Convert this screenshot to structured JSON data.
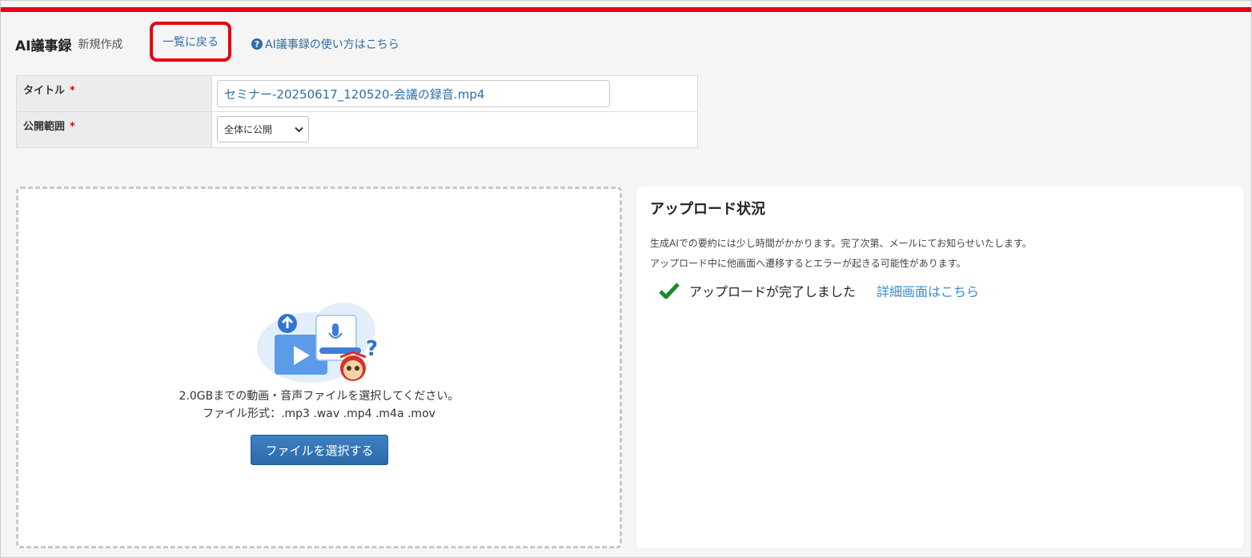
{
  "header": {
    "title": "AI議事録",
    "subtitle": "新規作成",
    "back_link": "一覧に戻る",
    "help_link": "AI議事録の使い方はこちら"
  },
  "form": {
    "title_label": "タイトル",
    "required_mark": "*",
    "title_value": "セミナー-20250617_120520-会議の録音.mp4",
    "scope_label": "公開範囲",
    "scope_selected": "全体に公開"
  },
  "dropzone": {
    "instruction": "2.0GBまでの動画・音声ファイルを選択してください。",
    "formats": "ファイル形式：.mp3 .wav .mp4 .m4a .mov",
    "button_label": "ファイルを選択する"
  },
  "status": {
    "title": "アップロード状況",
    "note1": "生成AIでの要約には少し時間がかかります。完了次第、メールにてお知らせいたします。",
    "note2": "アップロード中に他画面へ遷移するとエラーが起きる可能性があります。",
    "done_text": "アップロードが完了しました",
    "detail_link": "詳細画面はこちら"
  },
  "colors": {
    "brand_red": "#e60012",
    "link_blue": "#2e6da4",
    "success_green": "#1a8a2a"
  },
  "icons": {
    "help": "question-circle-icon",
    "check": "check-icon",
    "upload": "upload-illustration-icon",
    "chevron": "chevron-down-icon"
  }
}
